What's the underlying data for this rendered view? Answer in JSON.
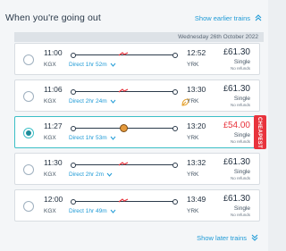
{
  "header": {
    "title": "When you're going out",
    "earlier_label": "Show earlier trains"
  },
  "date_label": "Wednesday 26th October 2022",
  "journeys": [
    {
      "dep": "11:00",
      "arr": "12:52",
      "from": "KGX",
      "to": "YRK",
      "duration": "Direct 1hr 52m",
      "price": "61.30",
      "ticket": "Single",
      "refund": "No refunds"
    },
    {
      "dep": "11:06",
      "arr": "13:30",
      "from": "KGX",
      "to": "YRK",
      "duration": "Direct 2hr 24m",
      "price": "61.30",
      "ticket": "Single",
      "refund": "No refunds"
    },
    {
      "dep": "11:27",
      "arr": "13:20",
      "from": "KGX",
      "to": "YRK",
      "duration": "Direct 1hr 53m",
      "price": "54.00",
      "ticket": "Single",
      "refund": "No refunds",
      "badge": "CHEAPEST"
    },
    {
      "dep": "11:30",
      "arr": "13:32",
      "from": "KGX",
      "to": "YRK",
      "duration": "Direct 2hr 2m",
      "price": "61.30",
      "ticket": "Single",
      "refund": "No refunds"
    },
    {
      "dep": "12:00",
      "arr": "13:49",
      "from": "KGX",
      "to": "YRK",
      "duration": "Direct 1hr 49m",
      "price": "61.30",
      "ticket": "Single",
      "refund": "No refunds"
    }
  ],
  "currency": "£",
  "later_label": "Show later trains",
  "colors": {
    "accent": "#1e9ad6",
    "selected_border": "#3bbfc6",
    "cheap": "#e8333c"
  }
}
